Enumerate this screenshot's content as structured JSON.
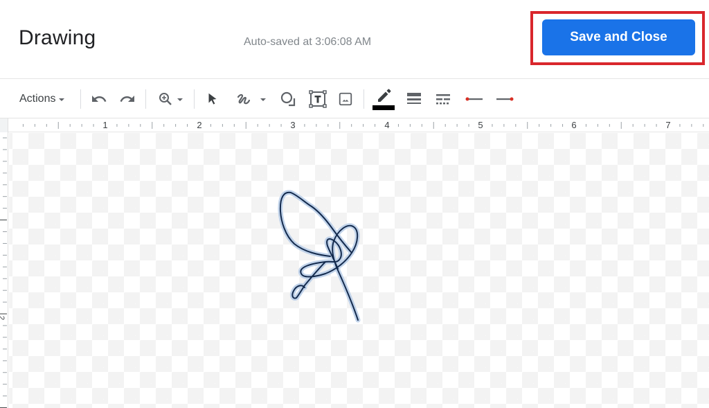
{
  "header": {
    "title": "Drawing",
    "autosave_status": "Auto-saved at 3:06:08 AM",
    "save_close_label": "Save and Close"
  },
  "colors": {
    "primary_button": "#1a73e8",
    "highlight_outline": "#d9262c",
    "line_color_swatch": "#000000",
    "arrow_endpoint": "#d93025",
    "signature_stroke": "#0d1f3c"
  },
  "toolbar": {
    "actions_label": "Actions",
    "items": [
      {
        "name": "undo-icon"
      },
      {
        "name": "redo-icon"
      },
      {
        "name": "zoom-icon"
      },
      {
        "name": "select-icon"
      },
      {
        "name": "line-scribble-icon"
      },
      {
        "name": "shape-icon"
      },
      {
        "name": "text-box-icon"
      },
      {
        "name": "image-icon"
      },
      {
        "name": "line-color-icon"
      },
      {
        "name": "line-weight-icon"
      },
      {
        "name": "line-dash-icon"
      },
      {
        "name": "line-start-icon"
      },
      {
        "name": "line-end-icon"
      }
    ]
  },
  "ruler": {
    "horizontal_labels": [
      "1",
      "2",
      "3",
      "4",
      "5",
      "6",
      "7"
    ],
    "vertical_labels": [
      "2"
    ]
  },
  "canvas": {
    "content": "freehand signature scribble"
  }
}
